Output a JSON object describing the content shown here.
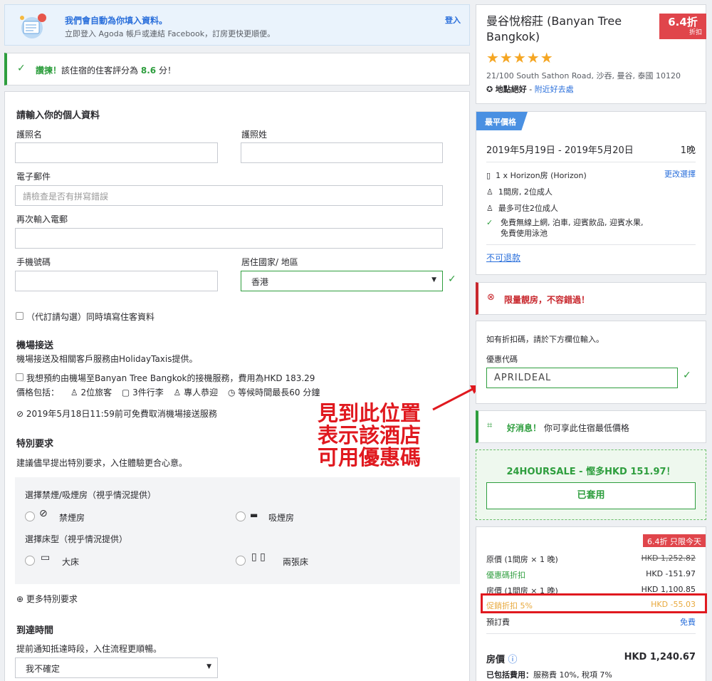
{
  "autofill": {
    "title": "我們會自動為你填入資料。",
    "subtitle": "立即登入 Agoda 帳戶或連結 Facebook，訂房更快更順便。",
    "login": "登入"
  },
  "rating": {
    "prefix": "讚揀！",
    "text": "該住宿的住客評分為",
    "score": "8.6",
    "suffix": "分！"
  },
  "form": {
    "section_title": "請輸入你的個人資料",
    "first_name_label": "護照名",
    "last_name_label": "護照姓",
    "email_label": "電子郵件",
    "email_placeholder": "請檢查是否有拼寫錯誤",
    "email_confirm_label": "再次輸入電郵",
    "phone_label": "手機號碼",
    "country_label": "居住國家/ 地區",
    "country_value": "香港",
    "proxy_label": "（代訂請勾選）同時填寫住客資料"
  },
  "transfer": {
    "title": "機場接送",
    "desc": "機場接送及相關客戶服務由HolidayTaxis提供。",
    "offer": "我想預約由機場至Banyan Tree Bangkok的接機服務，費用為HKD 183.29",
    "includes_label": "價格包括：",
    "inc_passengers": "2位旅客",
    "inc_luggage": "3件行李",
    "inc_driver": "專人恭迎",
    "inc_wait": "等候時間最長60 分鐘",
    "free_cancel": "2019年5月18日11:59前可免費取消機場接送服務"
  },
  "special": {
    "title": "特別要求",
    "desc": "建議儘早提出特別要求，入住體驗更合心意。",
    "smoking_title": "選擇禁煙/吸煙房（視乎情況提供）",
    "non_smoking": "禁煙房",
    "smoking": "吸煙房",
    "bed_title": "選擇床型（視乎情況提供）",
    "big_bed": "大床",
    "twin_bed": "兩張床",
    "more": "更多特別要求"
  },
  "arrival": {
    "title": "到達時間",
    "desc": "提前通知抵達時段，入住流程更順暢。",
    "value": "我不確定"
  },
  "annotation": {
    "line1": "見到此位置",
    "line2": "表示該酒店",
    "line3": "可用優惠碼"
  },
  "hotel": {
    "name": "曼谷悅榕莊 (Banyan Tree Bangkok)",
    "stars": "★★★★★",
    "address": "21/100 South Sathon Road, 沙吞, 曼谷, 泰國 10120",
    "location_label": "地點絕好",
    "nearby": "附近好去處",
    "discount": "6.4折",
    "discount_sub": "折扣"
  },
  "booking": {
    "badge": "最平價格",
    "dates": "2019年5月19日 - 2019年5月20日",
    "nights": "1晚",
    "room": "1 x Horizon房 (Horizon)",
    "change": "更改選擇",
    "guests": "1間房, 2位成人",
    "max": "最多可住2位成人",
    "perks": "免費無線上網, 泊車, 迎賓飲品, 迎賓水果, 免費使用泳池",
    "nonrefund": "不可退款"
  },
  "limited": {
    "text": "限量靚房，不容錯過！"
  },
  "promo": {
    "desc": "如有折扣碼，請於下方欄位輸入。",
    "label": "優惠代碼",
    "value": "APRILDEAL"
  },
  "good_news": {
    "prefix": "好消息！",
    "text": "你可享此住宿最低價格"
  },
  "sale": {
    "title": "24HOURSALE - 慳多HKD 151.97！",
    "applied": "已套用"
  },
  "price": {
    "badge": "6.4折 只限今天",
    "rows": [
      {
        "label": "原價 (1間房 × 1 晚)",
        "value": "HKD 1,252.82"
      },
      {
        "label": "優惠碼折扣",
        "value": "HKD -151.97"
      },
      {
        "label": "房價 (1間房 × 1 晚)",
        "value": "HKD 1,100.85"
      },
      {
        "label": "促銷折扣 5%",
        "value": "HKD -55.03"
      },
      {
        "label": "預訂費",
        "value": "免費"
      }
    ],
    "total_label": "房價",
    "total_value": "HKD 1,240.67",
    "included_label": "已包括費用：",
    "included_text": "服務費 10%, 稅項 7%"
  },
  "colors": {
    "accent": "#2a6fdb",
    "green": "#2e9e3e",
    "red": "#c8282e",
    "annotation": "#e0191f",
    "discount": "#e0454b"
  }
}
